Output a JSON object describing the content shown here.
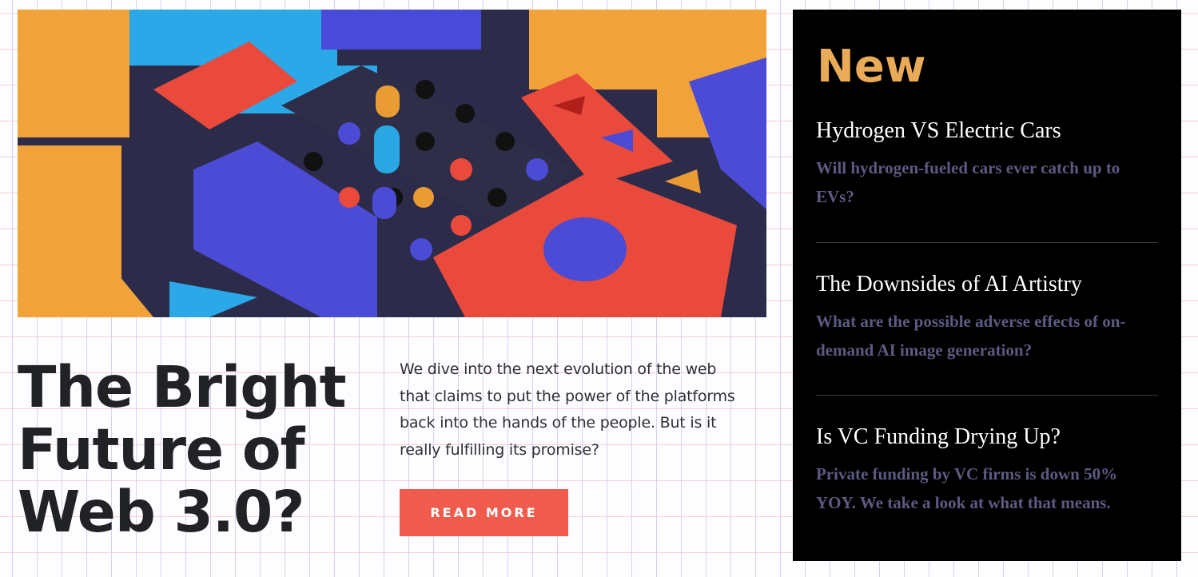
{
  "featured": {
    "title": "The Bright Future of Web 3.0?",
    "description": "We dive into the next evolution of the web that claims to put the power of the platforms back into the hands of the people. But is it really fulfilling its promise?",
    "button_label": "READ MORE",
    "button_color": "#ef5c4d",
    "image_icon": "abstract-blocks-image"
  },
  "sidebar": {
    "title": "New",
    "title_color": "#e9ab57",
    "items": [
      {
        "title": "Hydrogen VS Electric Cars",
        "summary": "Will hydrogen-fueled cars ever catch up to EVs?"
      },
      {
        "title": "The Downsides of AI Artistry",
        "summary": "What are the possible adverse effects of on-demand AI image generation?"
      },
      {
        "title": "Is VC Funding Drying Up?",
        "summary": "Private funding by VC firms is down 50% YOY. We take a look at what that means."
      }
    ]
  }
}
